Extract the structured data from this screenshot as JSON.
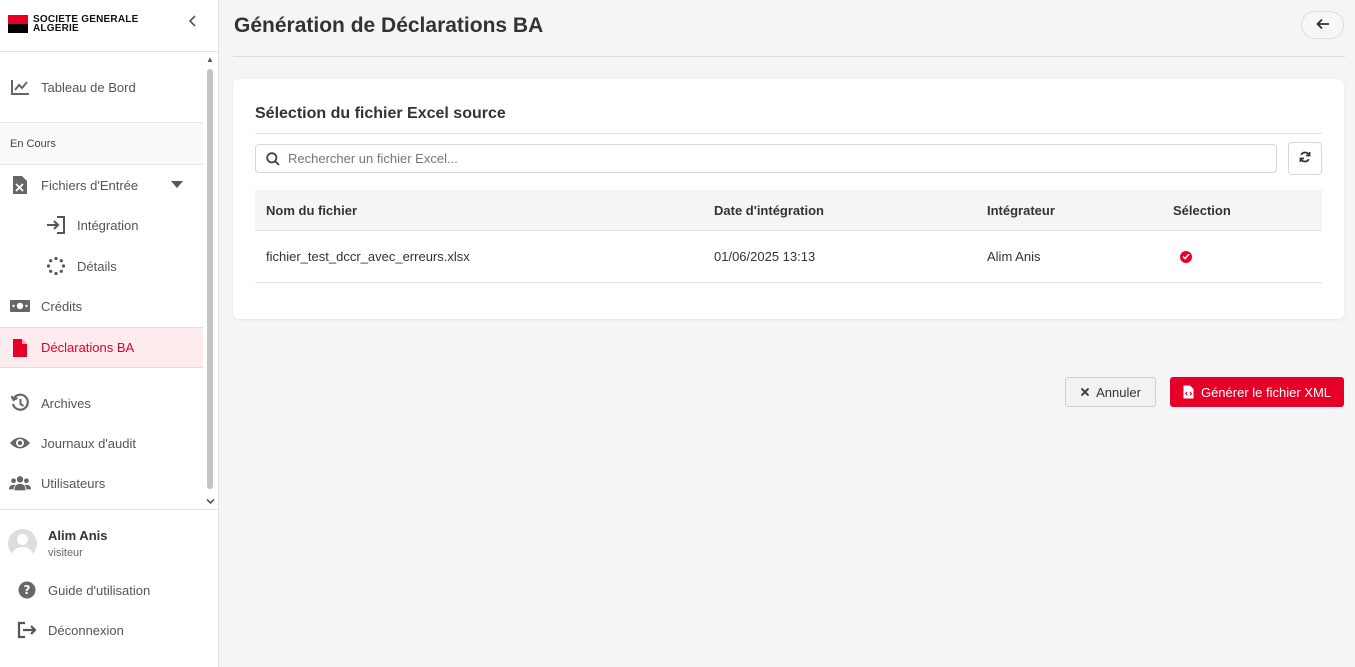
{
  "brand": {
    "line1": "SOCIETE GENERALE",
    "line2": "ALGERIE",
    "accent": "#e60028"
  },
  "sidebar": {
    "collapse_icon": "chevron-left-icon",
    "items": [
      {
        "label": "Tableau de Bord",
        "icon": "chart-line-icon"
      },
      {
        "label": "Fichiers d'Entrée",
        "icon": "file-excel-icon",
        "expanded": true
      },
      {
        "label": "Intégration",
        "icon": "sign-in-icon"
      },
      {
        "label": "Détails",
        "icon": "spinner-icon"
      },
      {
        "label": "Crédits",
        "icon": "money-bill-icon"
      },
      {
        "label": "Déclarations BA",
        "icon": "file-icon",
        "active": true
      },
      {
        "label": "Archives",
        "icon": "history-icon"
      },
      {
        "label": "Journaux d'audit",
        "icon": "eye-icon"
      },
      {
        "label": "Utilisateurs",
        "icon": "users-icon"
      }
    ],
    "group_label": "En Cours"
  },
  "user": {
    "name": "Alim Anis",
    "role": "visiteur"
  },
  "footer": {
    "guide": "Guide d'utilisation",
    "logout": "Déconnexion"
  },
  "header": {
    "title": "Génération de Déclarations BA",
    "back_icon": "arrow-left-icon"
  },
  "card": {
    "title": "Sélection du fichier Excel source",
    "search_placeholder": "Rechercher un fichier Excel...",
    "search_value": "",
    "refresh_icon": "sync-icon"
  },
  "table": {
    "headers": [
      "Nom du fichier",
      "Date d'intégration",
      "Intégrateur",
      "Sélection"
    ],
    "rows": [
      {
        "file": "fichier_test_dccr_avec_erreurs.xlsx",
        "date": "01/06/2025 13:13",
        "integrator": "Alim Anis",
        "selected": true
      }
    ]
  },
  "actions": {
    "cancel": "Annuler",
    "generate": "Générer le fichier XML"
  }
}
